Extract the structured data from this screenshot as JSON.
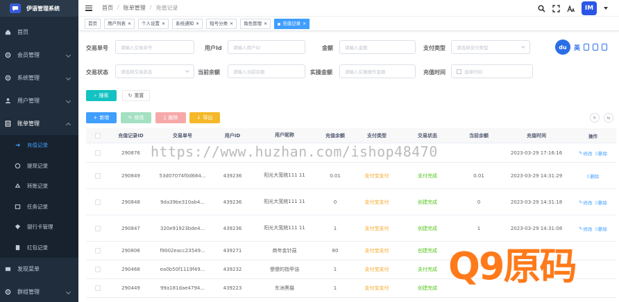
{
  "app": {
    "title": "伊语管理系统"
  },
  "sidebar": {
    "items": [
      {
        "label": "首页",
        "icon": "dashboard-icon"
      },
      {
        "label": "会员管理",
        "icon": "gear-icon"
      },
      {
        "label": "系统管理",
        "icon": "gear-icon"
      },
      {
        "label": "用户管理",
        "icon": "user-icon"
      },
      {
        "label": "账单管理",
        "icon": "bill-icon"
      }
    ],
    "submenu": [
      {
        "label": "充值记录",
        "icon": "recharge-icon"
      },
      {
        "label": "提现记录",
        "icon": "withdraw-icon"
      },
      {
        "label": "转账记录",
        "icon": "transfer-icon"
      },
      {
        "label": "任务记录",
        "icon": "task-icon"
      },
      {
        "label": "银行卡管理",
        "icon": "bank-icon"
      },
      {
        "label": "红包记录",
        "icon": "redpacket-icon"
      }
    ],
    "after": [
      {
        "label": "发现菜单",
        "icon": "discover-icon"
      },
      {
        "label": "群组管理",
        "icon": "group-icon"
      }
    ]
  },
  "breadcrumb": {
    "home": "首页",
    "parent": "账单管理",
    "current": "充值记录"
  },
  "header": {
    "avatar_text": "IM"
  },
  "tags": [
    "首页",
    "用户列表",
    "个人设置",
    "系统通知",
    "短号分类",
    "角色管理",
    "充值记录"
  ],
  "search": {
    "trade_no": {
      "label": "交易单号",
      "placeholder": "请输入交易单号"
    },
    "user_id": {
      "label": "用户Id",
      "placeholder": "请输入用户ID"
    },
    "amount": {
      "label": "金额",
      "placeholder": "请输入金额"
    },
    "pay_type": {
      "label": "支付类型",
      "placeholder": "请选择支付类型"
    },
    "trade_status": {
      "label": "交易状态",
      "placeholder": "请选择交易状态"
    },
    "current_balance": {
      "label": "当前余额",
      "placeholder": "请输入当前余额"
    },
    "actual_amount": {
      "label": "实操金额",
      "placeholder": "请输入实操操作金额"
    },
    "recharge_time": {
      "label": "充值时间",
      "placeholder": "选择时间"
    },
    "search_label": "搜索",
    "reset_label": "重置"
  },
  "toolbar": {
    "add": "新增",
    "edit": "修改",
    "delete": "删除",
    "export": "导出"
  },
  "baidu": {
    "logo": "du",
    "text": "英"
  },
  "table": {
    "columns": [
      "充值记录ID",
      "交易单号",
      "用户ID",
      "用户昵称",
      "充值余额",
      "支付类型",
      "交易状态",
      "当前余额",
      "充值时间",
      "操作"
    ],
    "ops": {
      "edit": "修改",
      "delete": "删除"
    },
    "rows": [
      {
        "id": "290876",
        "trade": "",
        "uid": "",
        "nick": "",
        "balance": "",
        "pay": "",
        "status": "",
        "current": "",
        "time": "2023-03-29 17:16:16"
      },
      {
        "id": "290849",
        "trade": "53d07074f0d684...",
        "uid": "439236",
        "nick": "阳光大宽统111 11",
        "balance": "0.01",
        "pay": "支付宝支付",
        "status": "支付完成",
        "current": "0.01",
        "time": "2023-03-29 14:31:29"
      },
      {
        "id": "290848",
        "trade": "9da39be310ab4...",
        "uid": "439236",
        "nick": "阳光大宽统111 11",
        "balance": "0",
        "pay": "支付宝支付",
        "status": "创建完成",
        "current": "0",
        "time": "2023-03-29 14:31:18"
      },
      {
        "id": "290847",
        "trade": "320e91923bde4...",
        "uid": "439236",
        "nick": "阳光大宽统111 11",
        "balance": "1",
        "pay": "支付宝支付",
        "status": "创建完成",
        "current": "1",
        "time": "2023-03-29 14:31:08"
      },
      {
        "id": "290806",
        "trade": "f9002eacc23549...",
        "uid": "439271",
        "nick": "商年金针菇",
        "balance": "80",
        "pay": "支付宝支付",
        "status": "创建完成",
        "current": "",
        "time": ""
      },
      {
        "id": "290468",
        "trade": "ea0b50f1119f49...",
        "uid": "439232",
        "nick": "傻傻的指甲油",
        "balance": "1",
        "pay": "支付宝支付",
        "status": "支付完成",
        "current": "",
        "time": ""
      },
      {
        "id": "290449",
        "trade": "99a181dae4794...",
        "uid": "439223",
        "nick": "东洲黑猫",
        "balance": "1",
        "pay": "支付宝支付",
        "status": "创建完成",
        "current": "",
        "time": ""
      }
    ]
  },
  "watermarks": {
    "url": "https://www.huzhan.com/ishop48470",
    "brand": "Q9原码"
  },
  "colors": {
    "sidebar_bg": "#1f2d3d",
    "accent": "#409eff",
    "search": "#13c2c2",
    "pay": "#f5a623",
    "success": "#52c41a"
  }
}
